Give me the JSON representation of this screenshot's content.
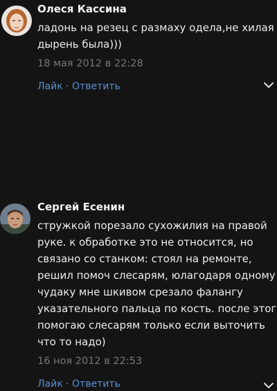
{
  "comments": [
    {
      "author": "Олеся Кассина",
      "text_lines": [
        "ладонь на резец с размаху одела,не хилая",
        "дырень была)))"
      ],
      "date": "18 мая 2012 в 22:28",
      "like_label": "Лайк",
      "separator": " · ",
      "reply_label": "Ответить"
    },
    {
      "author": "Сергей Есенин",
      "text_lines": [
        "стружкой порезало сухожилия на правой",
        "руке. к обработке это не относится, но",
        "связано со станком: стоял на ремонте,",
        "решил помоч слесарям, юлагодаря одному",
        "чудаку мне шкивом срезало фалангу",
        "указательного пальца по кость. после этого",
        "помогаю слесарям только если выточить",
        "что то надо)"
      ],
      "date": "16 ноя 2012 в 22:53",
      "like_label": "Лайк",
      "separator": " · ",
      "reply_label": "Ответить"
    }
  ],
  "colors": {
    "background": "#141414",
    "link": "#5b8fd4",
    "meta": "#777777"
  },
  "icons": {
    "expand": "chevron-down-icon"
  }
}
